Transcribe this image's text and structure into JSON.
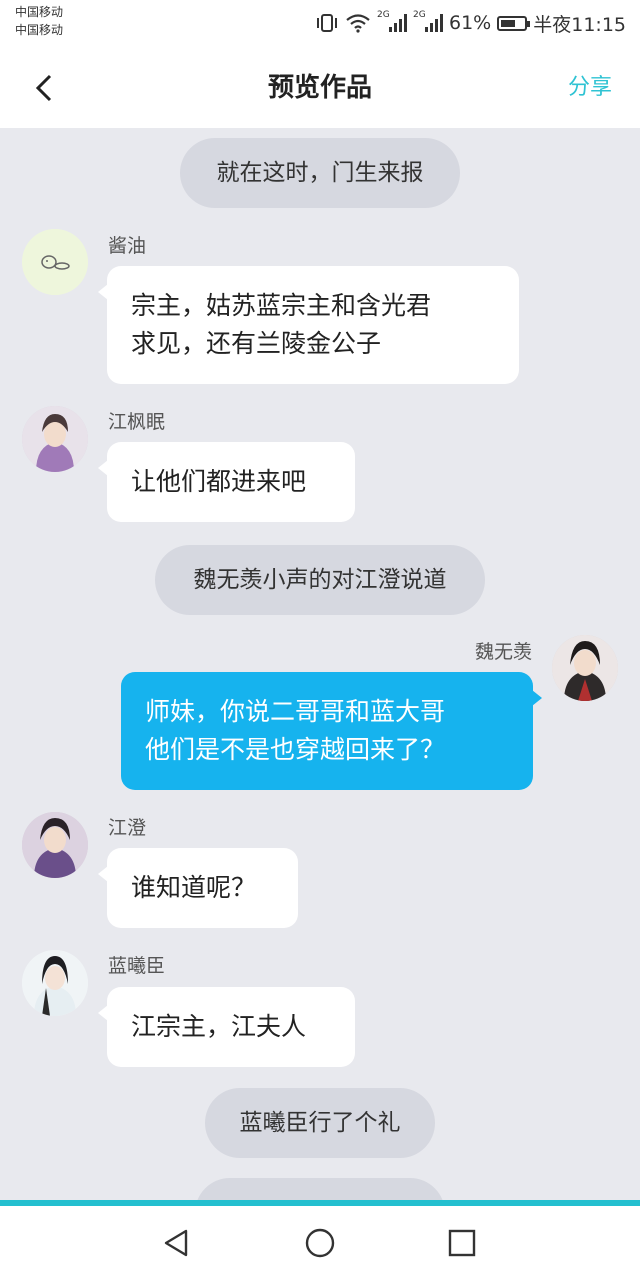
{
  "status_bar": {
    "carrier_1": "中国移动",
    "carrier_2": "中国移动",
    "network_1": "2G",
    "network_2": "2G",
    "battery_percent": "61%",
    "battery_level": 0.61,
    "time": "半夜11:15",
    "icons": [
      "vibrate-icon",
      "wifi-icon",
      "signal-icon",
      "battery-icon"
    ]
  },
  "header": {
    "title": "预览作品",
    "share_label": "分享",
    "back_icon": "chevron-left-icon",
    "accent_color": "#2fc3d3"
  },
  "chat": {
    "narrations": [
      "就在这时，门生来报",
      "魏无羡小声的对江澄说道",
      "蓝曦臣行了个礼"
    ],
    "messages": [
      {
        "sender": "酱油",
        "lines": [
          "宗主，姑苏蓝宗主和含光君",
          "求见，还有兰陵金公子"
        ]
      },
      {
        "sender": "江枫眠",
        "lines": [
          "让他们都进来吧"
        ]
      },
      {
        "sender": "魏无羡",
        "lines": [
          "师妹，你说二哥哥和蓝大哥",
          "他们是不是也穿越回来了？"
        ],
        "own": true
      },
      {
        "sender": "江澄",
        "lines": [
          "谁知道呢？"
        ]
      },
      {
        "sender": "蓝曦臣",
        "lines": [
          "江宗主，江夫人"
        ]
      }
    ],
    "own_bubble_color": "#16b3ee"
  },
  "system_nav": {
    "icons": [
      "back-triangle-icon",
      "home-circle-icon",
      "recents-square-icon"
    ]
  }
}
